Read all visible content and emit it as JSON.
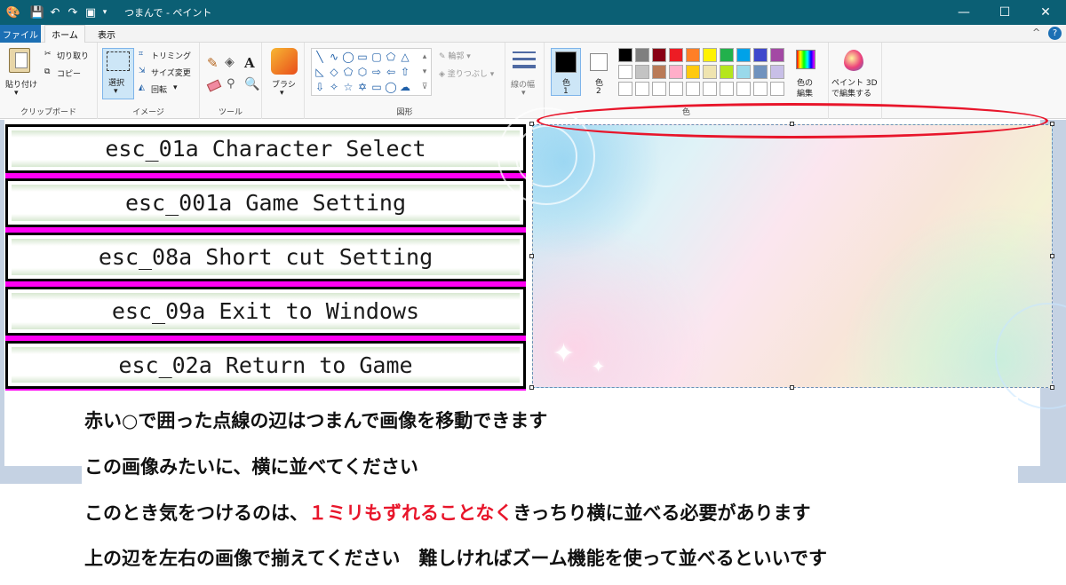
{
  "window": {
    "title": "つまんで - ペイント",
    "minimize_icon": "minimize-icon",
    "maximize_icon": "maximize-icon",
    "close_icon": "close-icon"
  },
  "menu": {
    "tabs": [
      "ファイル",
      "ホーム",
      "表示"
    ],
    "active_tab": "ホーム",
    "collapse_glyph": "^",
    "help_glyph": "?"
  },
  "ribbon": {
    "clipboard": {
      "paste_label": "貼り付け",
      "cut_label": "切り取り",
      "copy_label": "コピー",
      "group_label": "クリップボード"
    },
    "image": {
      "select_label": "選択",
      "crop_label": "トリミング",
      "resize_label": "サイズ変更",
      "rotate_label": "回転",
      "group_label": "イメージ"
    },
    "tools": {
      "text_glyph": "A",
      "group_label": "ツール"
    },
    "brush": {
      "label": "ブラシ"
    },
    "shapes": {
      "outline_label": "輪郭",
      "fill_label": "塗りつぶし",
      "group_label": "図形"
    },
    "size": {
      "label": "線の幅"
    },
    "colors": {
      "color1_label": "色",
      "color1_num": "1",
      "color2_label": "色",
      "color2_num": "2",
      "edit_colors_label_1": "色の",
      "edit_colors_label_2": "編集",
      "group_label": "色",
      "color1_value": "#000000",
      "palette_row1": [
        "#000000",
        "#7f7f7f",
        "#880015",
        "#ed1c24",
        "#ff7f27",
        "#fff200",
        "#22b14c",
        "#00a2e8",
        "#3f48cc",
        "#a349a4"
      ],
      "palette_row2": [
        "#ffffff",
        "#c3c3c3",
        "#b97a57",
        "#ffaec9",
        "#ffc90e",
        "#efe4b0",
        "#b5e61d",
        "#99d9ea",
        "#7092be",
        "#c8bfe7"
      ]
    },
    "paint3d": {
      "label_1": "ペイント 3D",
      "label_2": "で編集する"
    }
  },
  "canvas": {
    "menu_buttons": [
      "esc_01a Character Select",
      "esc_001a Game Setting",
      "esc_08a Short cut Setting",
      "esc_09a Exit to Windows",
      "esc_02a Return to Game"
    ],
    "accent_magenta": "#ff00f2",
    "annotation_color": "#e8162b"
  },
  "instructions": {
    "line1": "赤い○で囲った点線の辺はつまんで画像を移動できます",
    "line2": "この画像みたいに、横に並べてください",
    "line3_pre": "このとき気をつけるのは、",
    "line3_red": "１ミリもずれることなく",
    "line3_post": "きっちり横に並べる必要があります",
    "line4": "上の辺を左右の画像で揃えてください　難しければズーム機能を使って並べるといいです"
  }
}
